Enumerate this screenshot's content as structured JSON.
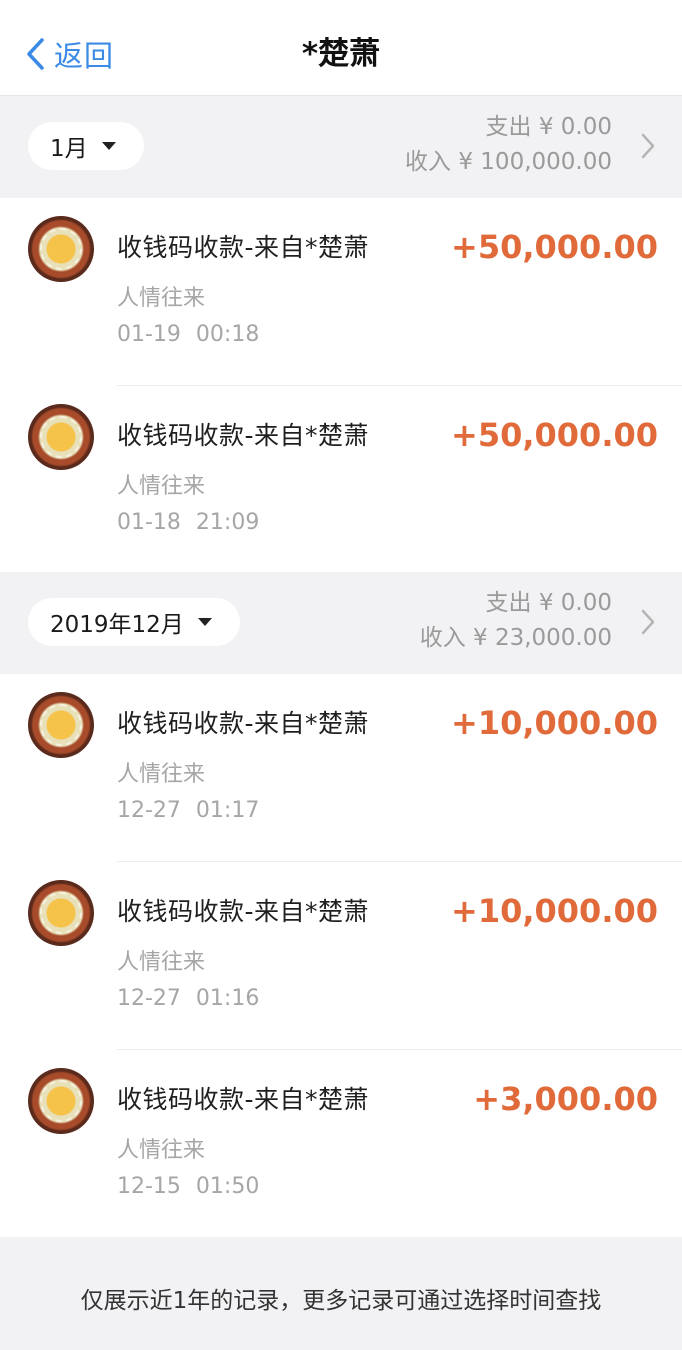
{
  "nav": {
    "back_label": "返回",
    "title": "*楚萧"
  },
  "sections": [
    {
      "month_label": "1月",
      "expense_text": "支出 ¥ 0.00",
      "income_text": "收入 ¥ 100,000.00",
      "rows": [
        {
          "title": "收钱码收款-来自*楚萧",
          "category": "人情往来",
          "time": "01-19 00:18",
          "amount": "+50,000.00"
        },
        {
          "title": "收钱码收款-来自*楚萧",
          "category": "人情往来",
          "time": "01-18 21:09",
          "amount": "+50,000.00"
        }
      ]
    },
    {
      "month_label": "2019年12月",
      "expense_text": "支出 ¥ 0.00",
      "income_text": "收入 ¥ 23,000.00",
      "rows": [
        {
          "title": "收钱码收款-来自*楚萧",
          "category": "人情往来",
          "time": "12-27 01:17",
          "amount": "+10,000.00"
        },
        {
          "title": "收钱码收款-来自*楚萧",
          "category": "人情往来",
          "time": "12-27 01:16",
          "amount": "+10,000.00"
        },
        {
          "title": "收钱码收款-来自*楚萧",
          "category": "人情往来",
          "time": "12-15 01:50",
          "amount": "+3,000.00"
        }
      ]
    }
  ],
  "footer": {
    "text": "仅展示近1年的记录，更多记录可通过选择时间查找"
  },
  "colors": {
    "accent_blue": "#3b8be6",
    "amount_orange": "#e06a3a",
    "section_bg": "#f2f2f4"
  },
  "icons": {
    "back": "chevron-left-icon",
    "month": "caret-down-icon",
    "summary": "chevron-right-icon"
  }
}
